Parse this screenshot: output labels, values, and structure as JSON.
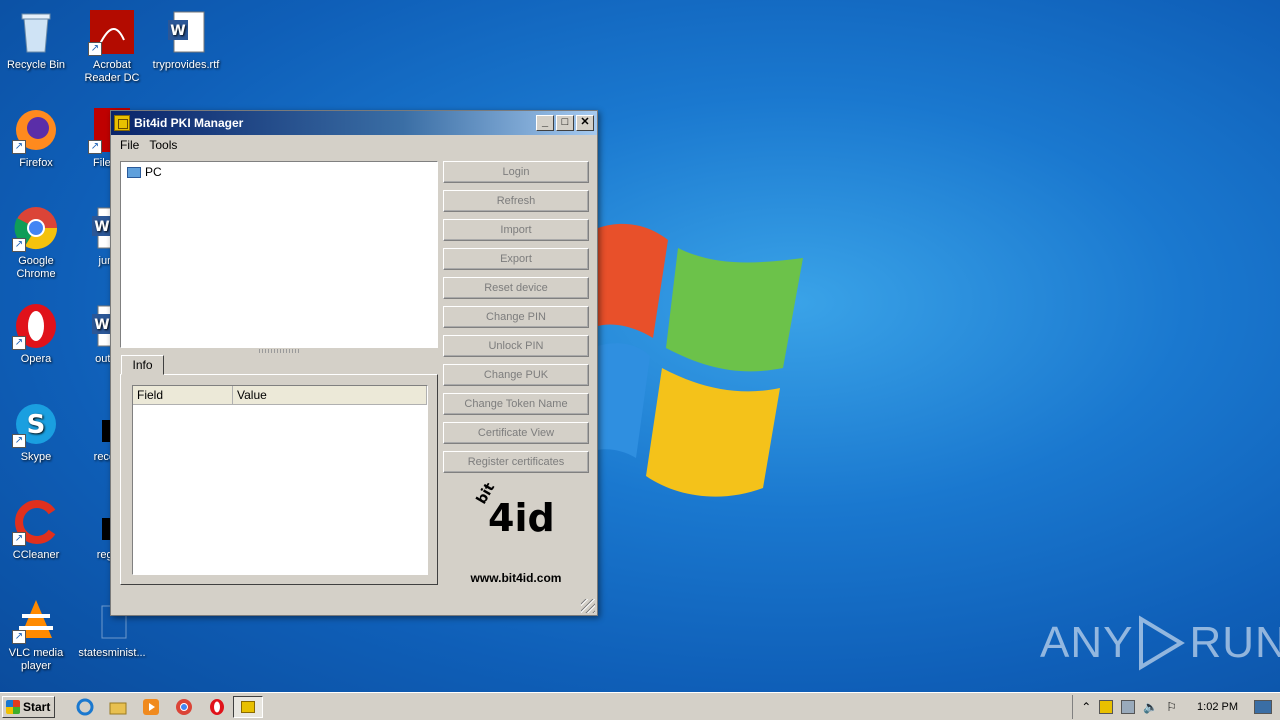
{
  "desktop": {
    "icons": [
      {
        "label": "Recycle Bin"
      },
      {
        "label": "Acrobat Reader DC"
      },
      {
        "label": "tryprovides.rtf"
      },
      {
        "label": "Firefox"
      },
      {
        "label": "FileZilla"
      },
      {
        "label": "Google Chrome"
      },
      {
        "label": "juneb"
      },
      {
        "label": "Opera"
      },
      {
        "label": "outdoo"
      },
      {
        "label": "Skype"
      },
      {
        "label": "recomn"
      },
      {
        "label": "CCleaner"
      },
      {
        "label": "registr"
      },
      {
        "label": "VLC media player"
      },
      {
        "label": "statesminist..."
      }
    ],
    "watermark": {
      "left": "ANY",
      "right": "RUN"
    }
  },
  "window": {
    "title": "Bit4id PKI Manager",
    "menu": [
      "File",
      "Tools"
    ],
    "tree_root": "PC",
    "tab": "Info",
    "columns": [
      "Field",
      "Value"
    ],
    "buttons": [
      "Login",
      "Refresh",
      "Import",
      "Export",
      "Reset device",
      "Change PIN",
      "Unlock PIN",
      "Change PUK",
      "Change Token Name",
      "Certificate View",
      "Register certificates"
    ],
    "brand_url": "www.bit4id.com",
    "brand_logo": {
      "top": "bit",
      "main": "4id"
    }
  },
  "taskbar": {
    "start_label": "Start",
    "clock": "1:02 PM"
  }
}
